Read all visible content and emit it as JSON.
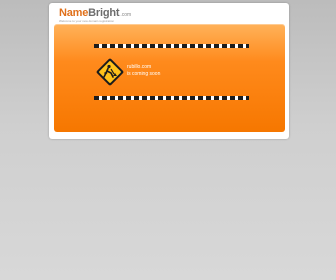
{
  "logo": {
    "name": "Name",
    "bright": "Bright",
    "tld": ".com",
    "tagline": "Welcome to your new domain registration"
  },
  "banner": {
    "domain": "rubillo.com",
    "status": "is coming soon",
    "icon": "under-construction-sign-icon"
  },
  "colors": {
    "banner_orange": "#ff8a1c",
    "logo_orange": "#e0701a",
    "background": "#cfcfcf"
  }
}
